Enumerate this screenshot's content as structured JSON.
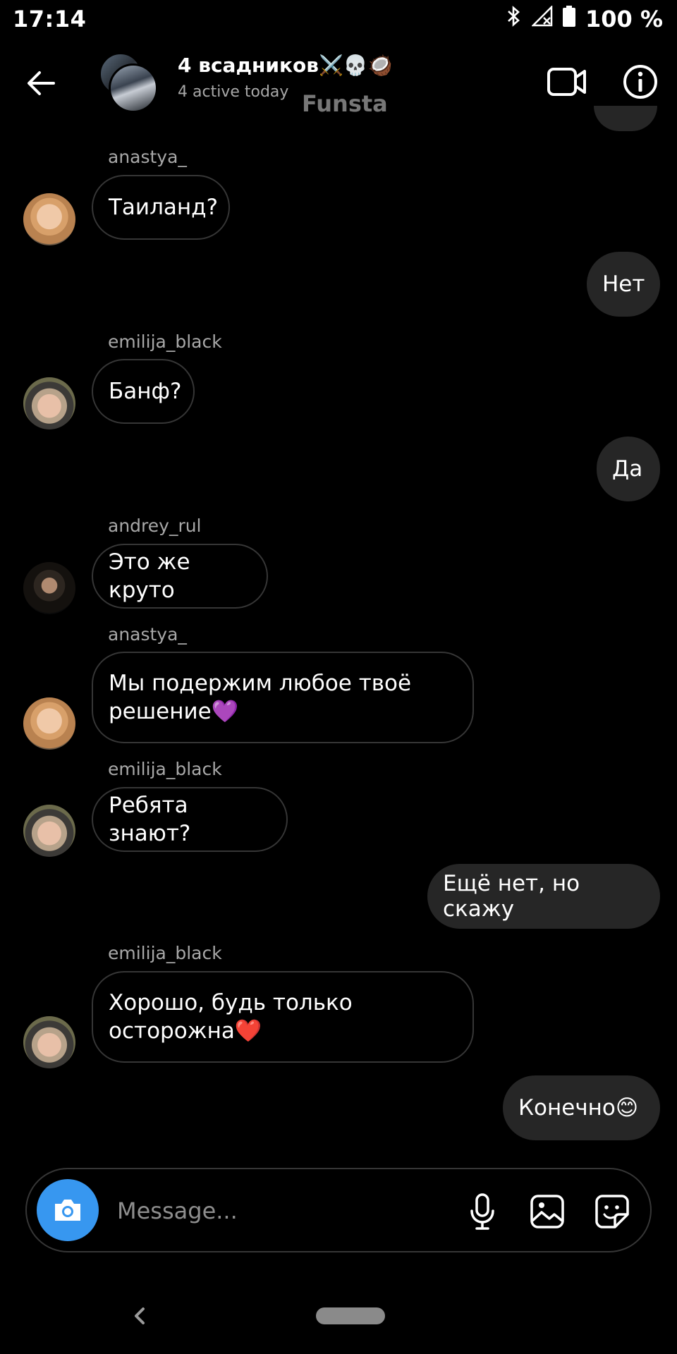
{
  "status_bar": {
    "time": "17:14",
    "battery": "100 %"
  },
  "header": {
    "title": "4 всадников⚔️💀🥥",
    "subtitle": "4 active today",
    "overlay_label": "Funsta"
  },
  "messages": [
    {
      "kind": "in",
      "username": "anastya_",
      "text": "Таиланд?"
    },
    {
      "kind": "out",
      "text": "Нет"
    },
    {
      "kind": "in",
      "username": "emilija_black",
      "text": "Банф?"
    },
    {
      "kind": "out",
      "text": "Да"
    },
    {
      "kind": "in",
      "username": "andrey_rul",
      "text": "Это же круто"
    },
    {
      "kind": "in",
      "username": "anastya_",
      "text": "Мы подержим любое твоё решение💜"
    },
    {
      "kind": "in",
      "username": "emilija_black",
      "text": "Ребята знают?"
    },
    {
      "kind": "out",
      "text": "Ещё нет, но скажу"
    },
    {
      "kind": "in",
      "username": "emilija_black",
      "text": "Хорошо, будь только осторожна❤️"
    },
    {
      "kind": "out",
      "text": "Конечно😊"
    }
  ],
  "composer": {
    "placeholder": "Message..."
  },
  "colors": {
    "background": "#000000",
    "outgoing_bubble": "#262626",
    "incoming_border": "#363636",
    "camera_button": "#3797f0",
    "secondary_text": "#a8a8a8"
  },
  "icons": [
    "back-arrow-icon",
    "video-call-icon",
    "info-icon",
    "camera-icon",
    "microphone-icon",
    "gallery-icon",
    "sticker-icon",
    "bluetooth-icon",
    "signal-icon",
    "battery-icon"
  ]
}
